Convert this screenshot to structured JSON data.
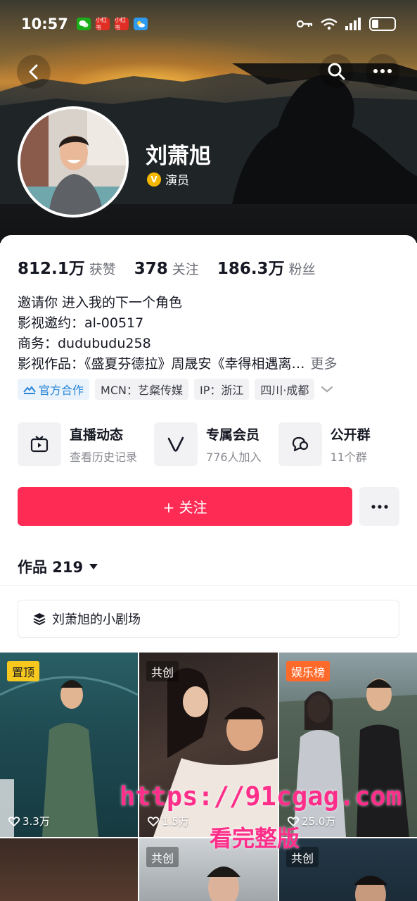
{
  "status_bar": {
    "time": "10:57",
    "apps": [
      {
        "icon": "wechat-icon",
        "color": "#1aad19"
      },
      {
        "icon": "xiaohongshu-icon",
        "color": "#e02e24",
        "label": "小红书"
      },
      {
        "icon": "xiaohongshu-icon",
        "color": "#e02e24",
        "label": "小红书"
      },
      {
        "icon": "weather-icon",
        "color": "#2f9bf0"
      }
    ],
    "indicators": [
      "key-icon",
      "wifi-icon",
      "signal-icon",
      "battery-icon"
    ]
  },
  "header": {
    "back_icon": "chevron-left-icon",
    "search_icon": "search-icon",
    "more_icon": "more-icon"
  },
  "profile": {
    "name": "刘萧旭",
    "verified_badge": "V",
    "verified_label": "演员"
  },
  "stats": [
    {
      "value": "812.1万",
      "label": "获赞"
    },
    {
      "value": "378",
      "label": "关注"
    },
    {
      "value": "186.3万",
      "label": "粉丝"
    }
  ],
  "bio": {
    "lines": [
      "邀请你 进入我的下一个角色",
      "影视邀约：al-00517",
      "商务：dudubudu258",
      "影视作品：《盛夏芬德拉》周晟安《幸得相遇离…"
    ],
    "more_label": "更多"
  },
  "tags": [
    {
      "label": "官方合作",
      "kind": "official"
    },
    {
      "label": "MCN：艺粲传媒",
      "kind": "normal"
    },
    {
      "label": "IP：浙江",
      "kind": "normal"
    },
    {
      "label": "四川·成都",
      "kind": "normal"
    }
  ],
  "services": [
    {
      "icon": "live-tv-icon",
      "title": "直播动态",
      "subtitle": "查看历史记录"
    },
    {
      "icon": "vip-v-icon",
      "title": "专属会员",
      "subtitle": "776人加入"
    },
    {
      "icon": "group-chat-icon",
      "title": "公开群",
      "subtitle": "11个群"
    }
  ],
  "actions": {
    "follow_label": "+ 关注",
    "more_icon": "more-icon"
  },
  "works": {
    "label": "作品 219",
    "playlist_label": "刘萧旭的小剧场"
  },
  "grid": [
    {
      "badge": "置顶",
      "badge_kind": "pin",
      "likes": "3.3万"
    },
    {
      "badge": "共创",
      "badge_kind": "co",
      "likes": "1.5万"
    },
    {
      "badge": "娱乐榜",
      "badge_kind": "ent",
      "likes": "25.0万"
    },
    {
      "badge": "",
      "badge_kind": "",
      "likes": ""
    },
    {
      "badge": "共创",
      "badge_kind": "co",
      "likes": ""
    },
    {
      "badge": "共创",
      "badge_kind": "co",
      "likes": ""
    }
  ],
  "watermark": {
    "url": "https://91cgag.com",
    "caption": "看完整版"
  },
  "colors": {
    "accent": "#fe2c55",
    "official": "#2a86d6",
    "pin_badge": "#f7c81e",
    "ent_badge": "#fe6a2a",
    "watermark": "#ff2e8a"
  }
}
